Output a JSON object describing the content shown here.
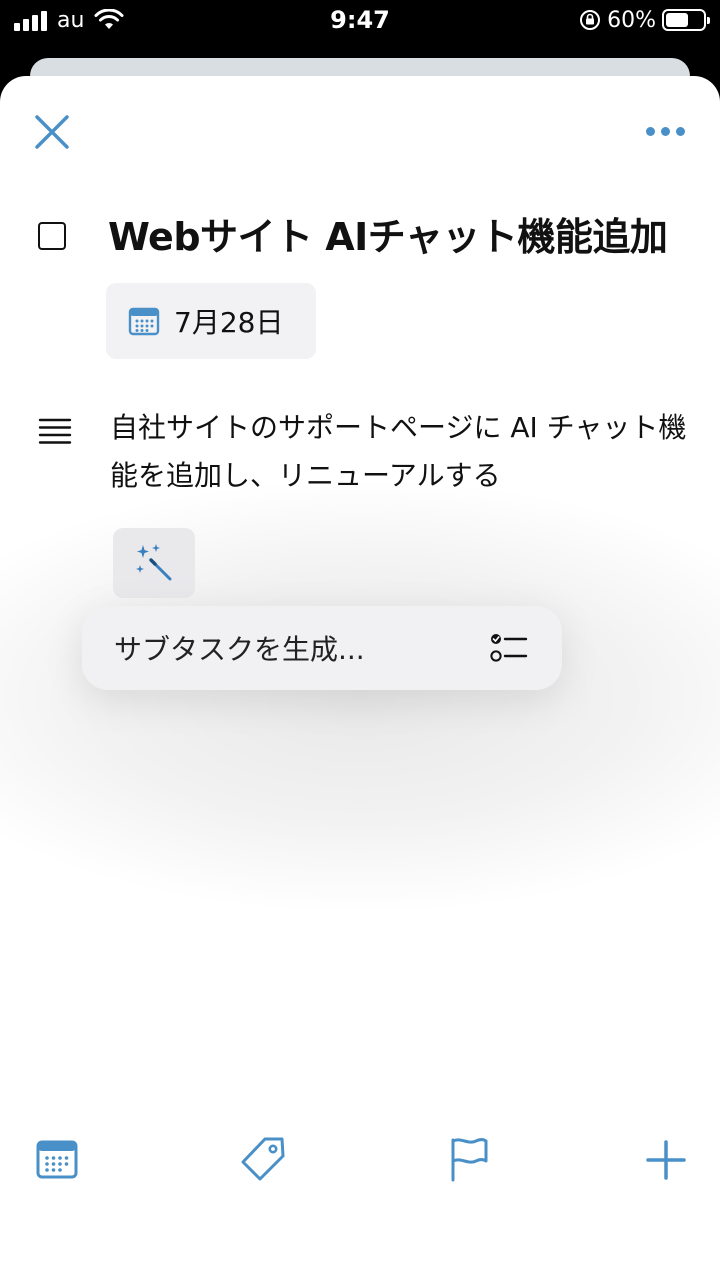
{
  "status_bar": {
    "carrier": "au",
    "time": "9:47",
    "battery_percent": "60%",
    "battery_level": 0.6
  },
  "header": {
    "close_icon": "close-icon",
    "more_icon": "more-icon"
  },
  "task": {
    "title": "Webサイト AIチャット機能追加",
    "date": "7月28日",
    "notes": "自社サイトのサポートページに AI チャット機能を追加し、リニューアルする"
  },
  "ai_menu": {
    "generate_subtasks_label": "サブタスクを生成..."
  },
  "toolbar": {
    "icons": [
      "calendar-icon",
      "tag-icon",
      "flag-icon",
      "plus-icon"
    ]
  },
  "colors": {
    "accent": "#4a90c8",
    "chip_bg": "#f2f2f4",
    "menu_bg": "#f1f1f3"
  }
}
